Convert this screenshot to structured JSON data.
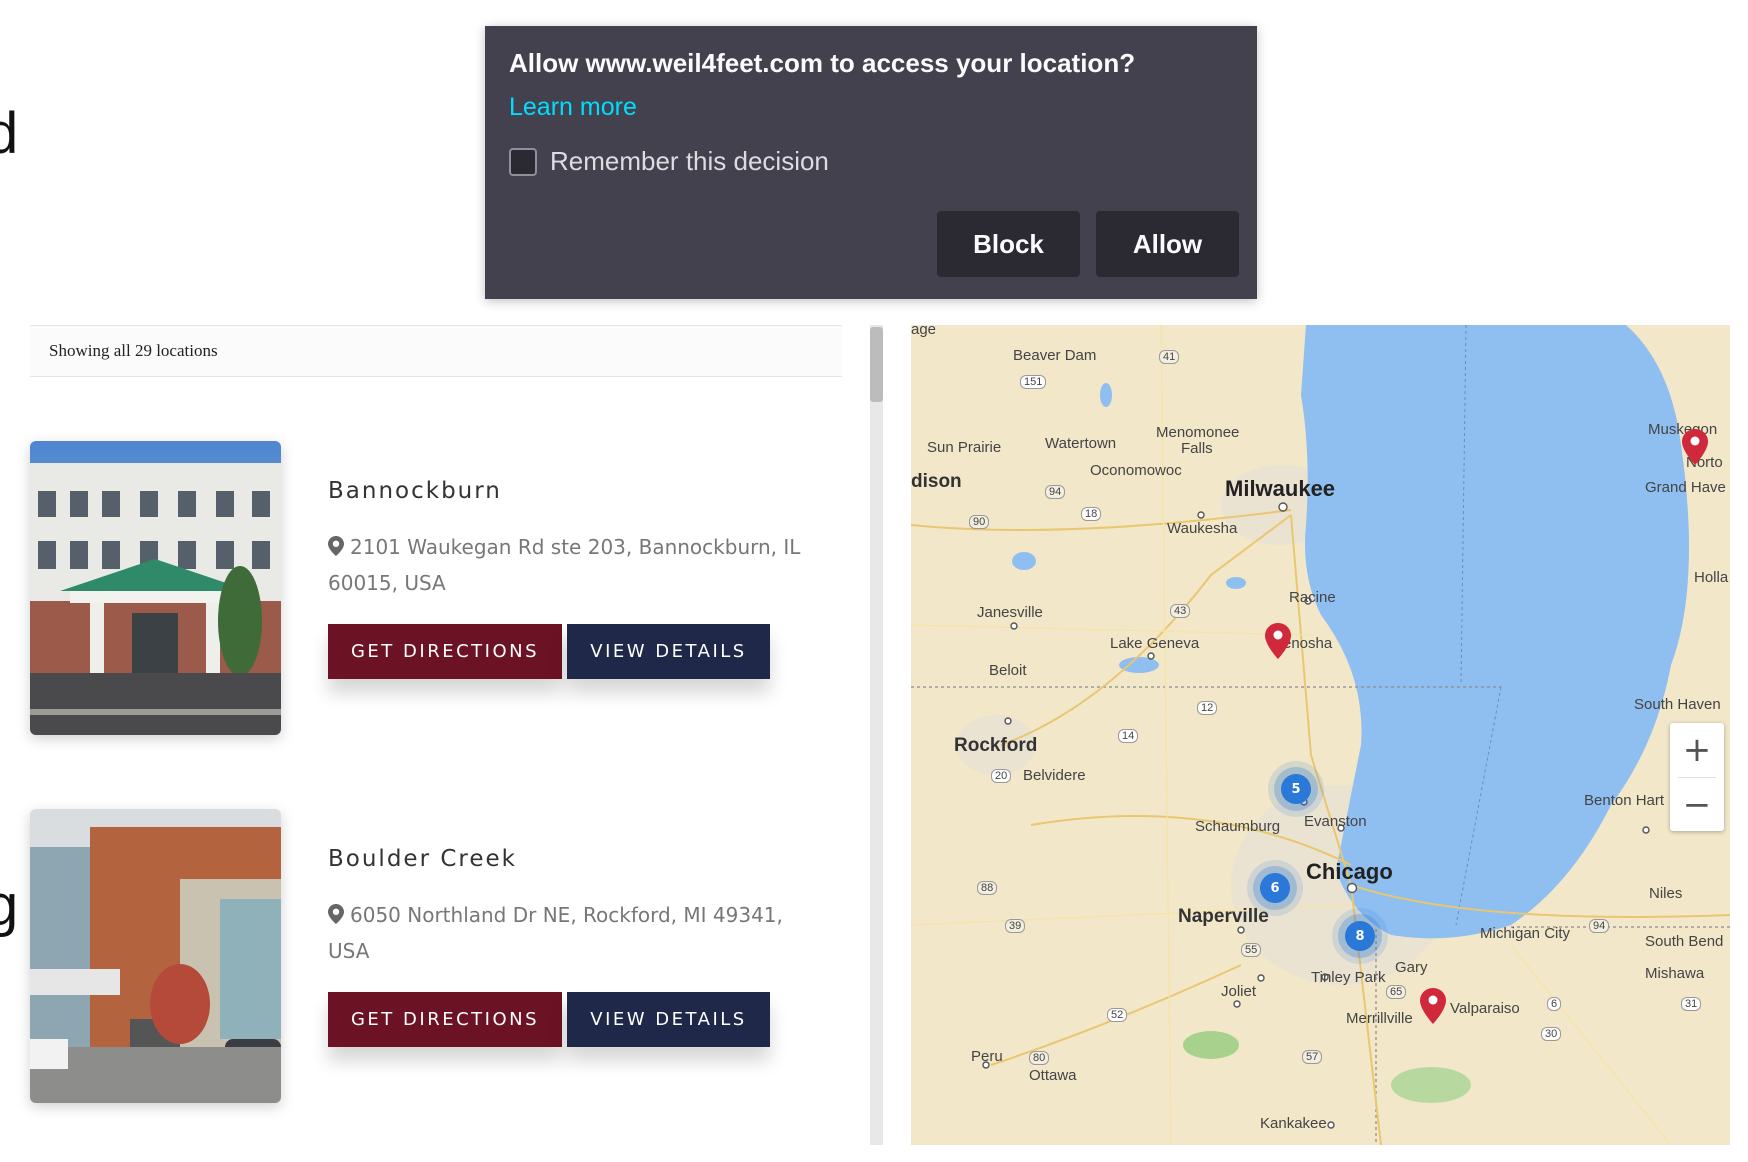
{
  "permission_prompt": {
    "title": "Allow www.weil4feet.com to access your location?",
    "learn_more": "Learn more",
    "remember_label": "Remember this decision",
    "block_label": "Block",
    "allow_label": "Allow"
  },
  "edge_glyphs": [
    "d",
    "g"
  ],
  "list": {
    "count_text": "Showing all 29 locations",
    "locations": [
      {
        "name": "Bannockburn",
        "address": "2101 Waukegan Rd ste 203, Bannockburn, IL 60015, USA",
        "directions_label": "GET DIRECTIONS",
        "details_label": "VIEW DETAILS"
      },
      {
        "name": "Boulder Creek",
        "address": "6050 Northland Dr NE, Rockford, MI 49341, USA",
        "directions_label": "GET DIRECTIONS",
        "details_label": "VIEW DETAILS"
      }
    ]
  },
  "map": {
    "labels": {
      "age": "age",
      "beaver_dam": "Beaver Dam",
      "sun_prairie": "Sun Prairie",
      "watertown": "Watertown",
      "menomonee": "Menomonee",
      "falls": "Falls",
      "oconomowoc": "Oconomowoc",
      "dison": "dison",
      "milwaukee": "Milwaukee",
      "waukesha": "Waukesha",
      "racine": "Racine",
      "janesville": "Janesville",
      "lake_geneva": "Lake Geneva",
      "kenosha": "enosha",
      "beloit": "Beloit",
      "rockford": "Rockford",
      "belvidere": "Belvidere",
      "schaumburg": "Schaumburg",
      "evanston": "Evanston",
      "chicago": "Chicago",
      "naperville": "Naperville",
      "tinley_park": "Tinley Park",
      "gary": "Gary",
      "joliet": "Joliet",
      "merrillville": "Merrillville",
      "valparaiso": "Valparaiso",
      "michigan_city": "Michigan City",
      "south_bend": "South Bend",
      "mishawa": "Mishawa",
      "peru": "Peru",
      "ottawa": "Ottawa",
      "kankakee": "Kankakee",
      "muskegon": "Muskegon",
      "norton": "Norto",
      "grand_haven": "Grand Have",
      "holland": "Holla",
      "south_haven": "South Haven",
      "benton_harbor": "Benton Hart",
      "niles": "Niles"
    },
    "highway_shields": [
      "151",
      "41",
      "94",
      "18",
      "90",
      "43",
      "12",
      "14",
      "20",
      "88",
      "39",
      "55",
      "57",
      "80",
      "52",
      "65",
      "6",
      "31",
      "30",
      "94"
    ],
    "clusters": [
      {
        "count": "5"
      },
      {
        "count": "6"
      },
      {
        "count": "8"
      }
    ],
    "zoom_in": "+",
    "zoom_out": "−",
    "colors": {
      "land": "#f2e7c9",
      "water": "#8fbef0",
      "marker": "#d0293b",
      "cluster": "#2a78d8"
    }
  },
  "icons": {
    "location_pin": "map-pin-icon",
    "marker": "map-marker-icon"
  }
}
